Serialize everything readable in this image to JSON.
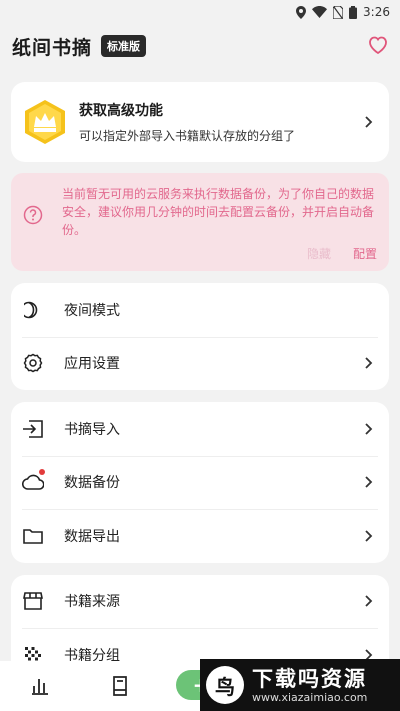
{
  "status_bar": {
    "time": "3:26"
  },
  "header": {
    "title": "纸间书摘",
    "badge": "标准版"
  },
  "premium": {
    "title": "获取高级功能",
    "subtitle": "可以指定外部导入书籍默认存放的分组了"
  },
  "alert": {
    "message": "当前暂无可用的云服务来执行数据备份，为了你自己的数据安全，建议你用几分钟的时间去配置云备份，并开启自动备份。",
    "hide_label": "隐藏",
    "config_label": "配置"
  },
  "menu_display": [
    {
      "label": "夜间模式",
      "icon": "moon-icon"
    },
    {
      "label": "应用设置",
      "icon": "gear-icon"
    }
  ],
  "menu_data": [
    {
      "label": "书摘导入",
      "icon": "import-icon"
    },
    {
      "label": "数据备份",
      "icon": "cloud-icon"
    },
    {
      "label": "数据导出",
      "icon": "folder-icon"
    }
  ],
  "menu_books": [
    {
      "label": "书籍来源",
      "icon": "store-icon"
    },
    {
      "label": "书籍分组",
      "icon": "grid-dots-icon"
    }
  ],
  "bottom_nav": {
    "add_symbol": "+"
  },
  "watermark": {
    "title": "下载吗资源",
    "url": "www.xiazaimiao.com"
  },
  "colors": {
    "accent_pink": "#e2688d",
    "alert_bg": "#f8e1e6",
    "heart": "#e0557a",
    "nav_green": "#6cc377"
  }
}
